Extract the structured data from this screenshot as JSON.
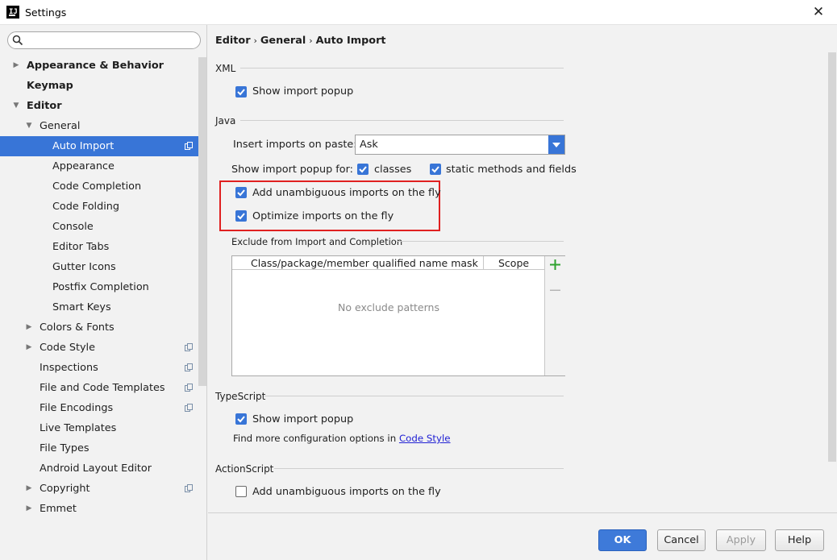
{
  "window": {
    "title": "Settings",
    "close_glyph": "✕"
  },
  "search": {
    "placeholder": ""
  },
  "sidebar": {
    "items": [
      {
        "label": "Appearance & Behavior",
        "arrow": "▶"
      },
      {
        "label": "Keymap",
        "arrow": ""
      },
      {
        "label": "Editor",
        "arrow": "▼"
      },
      {
        "label": "General",
        "arrow": "▼"
      },
      {
        "label": "Auto Import",
        "arrow": ""
      },
      {
        "label": "Appearance",
        "arrow": ""
      },
      {
        "label": "Code Completion",
        "arrow": ""
      },
      {
        "label": "Code Folding",
        "arrow": ""
      },
      {
        "label": "Console",
        "arrow": ""
      },
      {
        "label": "Editor Tabs",
        "arrow": ""
      },
      {
        "label": "Gutter Icons",
        "arrow": ""
      },
      {
        "label": "Postfix Completion",
        "arrow": ""
      },
      {
        "label": "Smart Keys",
        "arrow": ""
      },
      {
        "label": "Colors & Fonts",
        "arrow": "▶"
      },
      {
        "label": "Code Style",
        "arrow": "▶"
      },
      {
        "label": "Inspections",
        "arrow": ""
      },
      {
        "label": "File and Code Templates",
        "arrow": ""
      },
      {
        "label": "File Encodings",
        "arrow": ""
      },
      {
        "label": "Live Templates",
        "arrow": ""
      },
      {
        "label": "File Types",
        "arrow": ""
      },
      {
        "label": "Android Layout Editor",
        "arrow": ""
      },
      {
        "label": "Copyright",
        "arrow": "▶"
      },
      {
        "label": "Emmet",
        "arrow": "▶"
      }
    ],
    "selected": "Auto Import"
  },
  "breadcrumb": {
    "part1": "Editor",
    "part2": "General",
    "part3": "Auto Import",
    "separator": "›"
  },
  "xml": {
    "title": "XML",
    "show_import_popup": {
      "label": "Show import popup",
      "checked": true
    }
  },
  "java": {
    "title": "Java",
    "insert_imports_label": "Insert imports on paste:",
    "insert_imports_value": "Ask",
    "show_popup_for_label": "Show import popup for:",
    "classes": {
      "label": "classes",
      "checked": true
    },
    "static_methods": {
      "label": "static methods and fields",
      "checked": true
    },
    "add_unambiguous": {
      "label": "Add unambiguous imports on the fly",
      "checked": true
    },
    "optimize_imports": {
      "label": "Optimize imports on the fly",
      "checked": true
    },
    "exclude_title": "Exclude from Import and Completion",
    "table": {
      "columns": [
        "Class/package/member qualified name mask",
        "Scope"
      ],
      "empty_text": "No exclude patterns",
      "add_glyph": "+",
      "remove_glyph": "−"
    }
  },
  "typescript": {
    "title": "TypeScript",
    "show_import_popup": {
      "label": "Show import popup",
      "checked": true
    },
    "find_more_text": "Find more configuration options in",
    "find_more_link": "Code Style"
  },
  "actionscript": {
    "title": "ActionScript",
    "add_unambiguous": {
      "label": "Add unambiguous imports on the fly",
      "checked": false
    }
  },
  "footer": {
    "ok": "OK",
    "cancel": "Cancel",
    "apply": "Apply",
    "help": "Help"
  },
  "colors": {
    "accent": "#3875d7",
    "highlight_border": "#e02020",
    "link": "#2121d4",
    "add_icon": "#2fa32f"
  }
}
